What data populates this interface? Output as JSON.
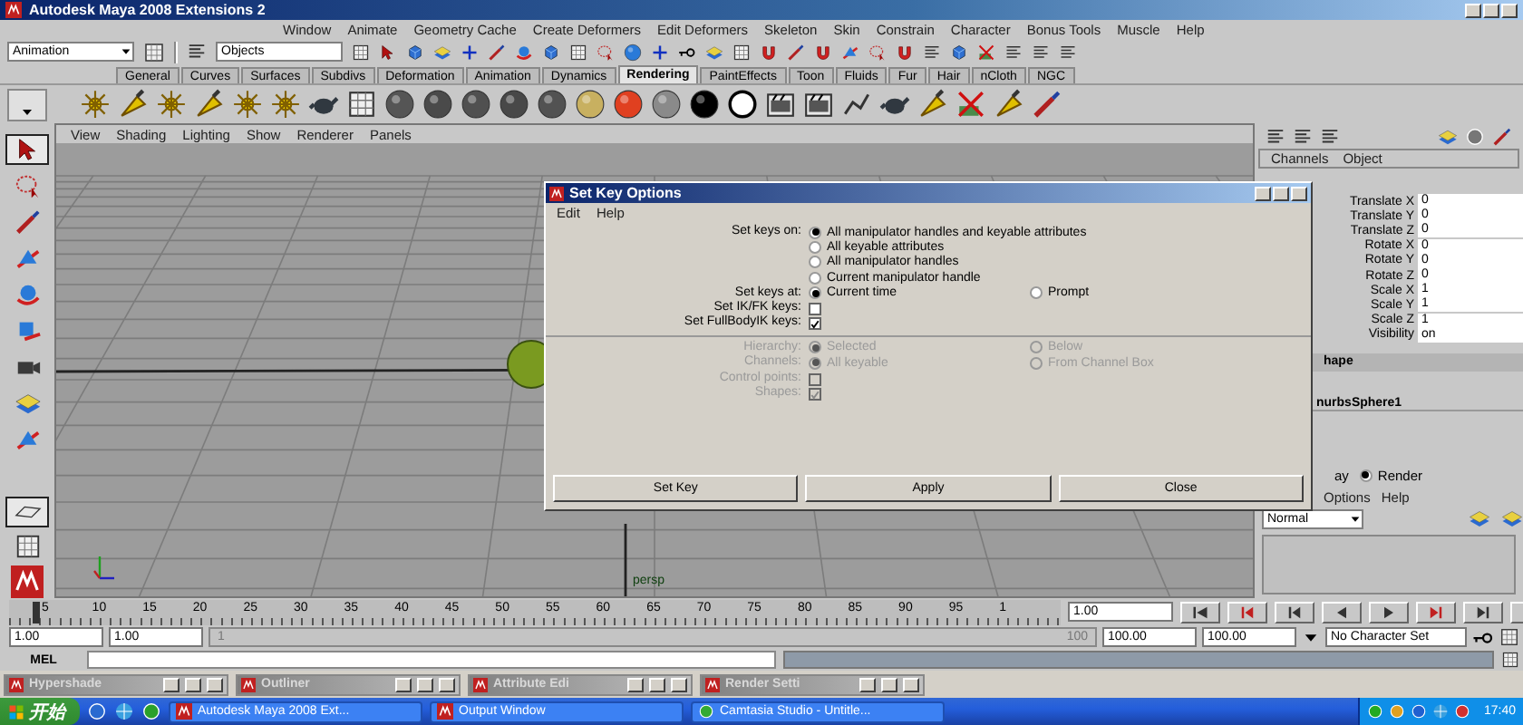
{
  "window": {
    "title": "Autodesk Maya 2008 Extensions 2"
  },
  "menu": [
    "Window",
    "Animate",
    "Geometry Cache",
    "Create Deformers",
    "Edit Deformers",
    "Skeleton",
    "Skin",
    "Constrain",
    "Character",
    "Bonus Tools",
    "Muscle",
    "Help"
  ],
  "status_line": {
    "mode": "Animation",
    "selection_mask": "Objects"
  },
  "shelf_tabs": [
    {
      "label": "General",
      "selected": false
    },
    {
      "label": "Curves",
      "selected": false
    },
    {
      "label": "Surfaces",
      "selected": false
    },
    {
      "label": "Subdivs",
      "selected": false
    },
    {
      "label": "Deformation",
      "selected": false
    },
    {
      "label": "Animation",
      "selected": false
    },
    {
      "label": "Dynamics",
      "selected": false
    },
    {
      "label": "Rendering",
      "selected": true
    },
    {
      "label": "PaintEffects",
      "selected": false
    },
    {
      "label": "Toon",
      "selected": false
    },
    {
      "label": "Fluids",
      "selected": false
    },
    {
      "label": "Fur",
      "selected": false
    },
    {
      "label": "Hair",
      "selected": false
    },
    {
      "label": "nCloth",
      "selected": false
    },
    {
      "label": "NGC",
      "selected": false
    }
  ],
  "panel_menu": [
    "View",
    "Shading",
    "Lighting",
    "Show",
    "Renderer",
    "Panels"
  ],
  "viewport": {
    "camera": "persp"
  },
  "channel_box": {
    "menus": [
      "Channels",
      "Object"
    ],
    "attributes": [
      {
        "name": "Translate X",
        "value": "0"
      },
      {
        "name": "Translate Y",
        "value": "0"
      },
      {
        "name": "Translate Z",
        "value": "0"
      },
      {
        "name": "Rotate X",
        "value": "0"
      },
      {
        "name": "Rotate Y",
        "value": "0"
      },
      {
        "name": "Rotate Z",
        "value": "0"
      },
      {
        "name": "Scale X",
        "value": "1"
      },
      {
        "name": "Scale Y",
        "value": "1"
      },
      {
        "name": "Scale Z",
        "value": "1"
      },
      {
        "name": "Visibility",
        "value": "on"
      }
    ],
    "section_header": "hape",
    "shape": "nurbsSphere1",
    "layer_tab_fragment": "ay",
    "layer_mode": {
      "label": "Render",
      "selected": true
    },
    "layer_menus": [
      "Options",
      "Help"
    ],
    "blend_mode": "Normal"
  },
  "dialog": {
    "title": "Set Key Options",
    "menus": [
      "Edit",
      "Help"
    ],
    "sections": [
      {
        "disabled": false,
        "rows": [
          {
            "kind": "radio_list",
            "label": "Set keys on:",
            "options": [
              {
                "label": "All manipulator handles and keyable attributes",
                "selected": true
              },
              {
                "label": "All keyable attributes",
                "selected": false
              },
              {
                "label": "All manipulator handles",
                "selected": false
              },
              {
                "label": "Current manipulator handle",
                "selected": false
              }
            ]
          },
          {
            "kind": "radio_row",
            "label": "Set keys at:",
            "options": [
              {
                "label": "Current time",
                "selected": true
              },
              {
                "label": "Prompt",
                "selected": false
              }
            ]
          },
          {
            "kind": "checkbox",
            "label": "Set IK/FK keys:",
            "checked": false
          },
          {
            "kind": "checkbox",
            "label": "Set FullBodyIK keys:",
            "checked": true
          }
        ]
      },
      {
        "disabled": true,
        "rows": [
          {
            "kind": "radio_row",
            "label": "Hierarchy:",
            "options": [
              {
                "label": "Selected",
                "selected": true
              },
              {
                "label": "Below",
                "selected": false
              }
            ]
          },
          {
            "kind": "radio_row",
            "label": "Channels:",
            "options": [
              {
                "label": "All keyable",
                "selected": true
              },
              {
                "label": "From Channel Box",
                "selected": false
              }
            ]
          },
          {
            "kind": "checkbox",
            "label": "Control points:",
            "checked": false
          },
          {
            "kind": "checkbox",
            "label": "Shapes:",
            "checked": true
          }
        ]
      }
    ],
    "buttons": [
      "Set Key",
      "Apply",
      "Close"
    ]
  },
  "time_slider": {
    "ticks": [
      "5",
      "10",
      "15",
      "20",
      "25",
      "30",
      "35",
      "40",
      "45",
      "50",
      "55",
      "60",
      "65",
      "70",
      "75",
      "80",
      "85",
      "90",
      "95",
      "1"
    ],
    "current_frame": "1.00",
    "level": 0
  },
  "range_slider": {
    "start": "1.00",
    "playback_start": "1.00",
    "bar_start": "1",
    "bar_end": "100",
    "level": 1,
    "playback_end": "100.00",
    "end": "100.00",
    "character_set": "No Character Set"
  },
  "command_line": {
    "label": "MEL"
  },
  "minimized_windows": [
    "Hypershade",
    "Outliner",
    "Attribute Edi",
    "Render Setti"
  ],
  "taskbar": {
    "start": "开始",
    "tasks": [
      "Autodesk Maya 2008 Ext...",
      "Output Window",
      "Camtasia Studio - Untitle..."
    ],
    "clock": "17:40"
  }
}
